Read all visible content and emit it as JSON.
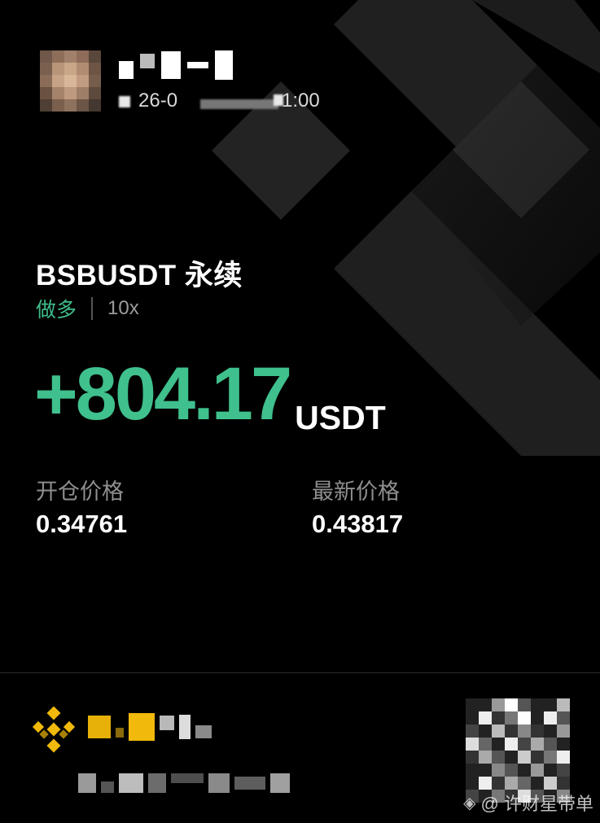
{
  "header": {
    "timestamp_fragment_date": "26-0",
    "timestamp_fragment_time": "1:00"
  },
  "position": {
    "symbol": "BSBUSDT 永续",
    "side": "做多",
    "leverage": "10x",
    "pnl_value": "+804.17",
    "pnl_unit": "USDT"
  },
  "prices": {
    "entry_label": "开仓价格",
    "entry_value": "0.34761",
    "last_label": "最新价格",
    "last_value": "0.43817"
  },
  "watermark": {
    "text": "@ 许财星带单"
  },
  "colors": {
    "background": "#000000",
    "profit_green": "#3fc08c",
    "side_green": "#3fbc8a",
    "brand_yellow": "#f0b90b"
  },
  "icons": {
    "background": "binance-logo-icon",
    "footer": "binance-logo-icon",
    "watermark": "weibo-icon"
  }
}
